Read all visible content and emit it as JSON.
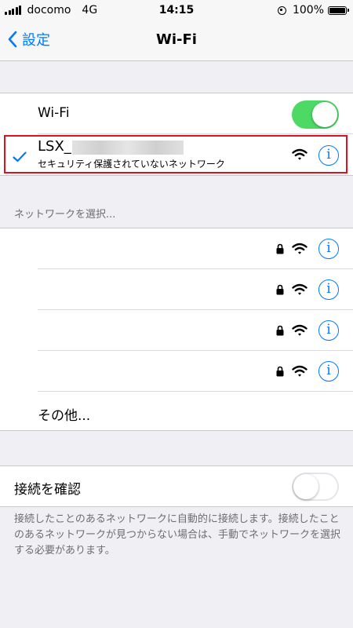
{
  "status_bar": {
    "carrier": "docomo",
    "network": "4G",
    "time": "14:15",
    "battery": "100%",
    "battery_level": 1.0,
    "icons": [
      "signal-bars-icon",
      "rotation-lock-icon",
      "battery-icon"
    ]
  },
  "nav": {
    "back_label": "設定",
    "title": "Wi-Fi",
    "back_icon": "chevron-left-icon"
  },
  "wifi_row": {
    "label": "Wi-Fi",
    "toggle_on": true
  },
  "connected_network": {
    "ssid": "LSX_",
    "subtitle": "セキュリティ保護されていないネットワーク",
    "checkmark_icon": "checkmark-icon",
    "wifi_icon": "wifi-icon",
    "info_label": "i"
  },
  "choose_network": {
    "header": "ネットワークを選択...",
    "networks": [
      {
        "ssid": "",
        "locked": true,
        "info_label": "i"
      },
      {
        "ssid": "",
        "locked": true,
        "info_label": "i"
      },
      {
        "ssid": "",
        "locked": true,
        "info_label": "i"
      },
      {
        "ssid": "",
        "locked": true,
        "info_label": "i"
      }
    ],
    "other_label": "その他..."
  },
  "ask_to_join": {
    "label": "接続を確認",
    "toggle_on": false,
    "footer": "接続したことのあるネットワークに自動的に接続します。接続したことのあるネットワークが見つからない場合は、手動でネットワークを選択する必要があります。"
  },
  "colors": {
    "accent": "#007aff",
    "toggle_on": "#4cd964",
    "highlight_border": "#e0111e",
    "background": "#efeff4"
  }
}
